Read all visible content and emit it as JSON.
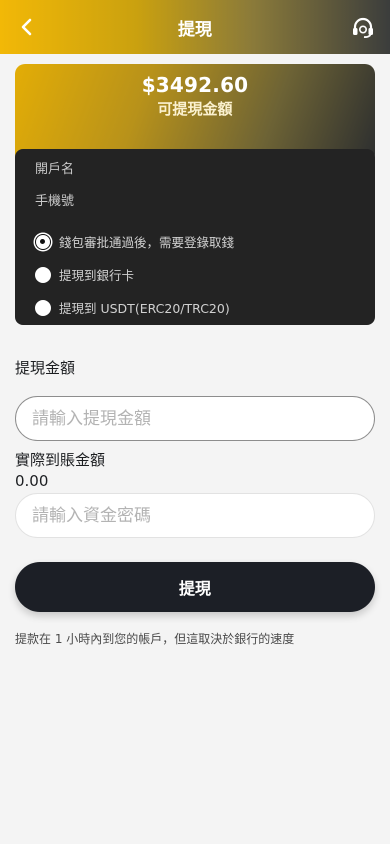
{
  "header": {
    "title": "提現",
    "back_icon": "chevron-left-icon",
    "support_icon": "headset-icon"
  },
  "balance": {
    "amount": "$3492.60",
    "label": "可提現金額"
  },
  "account": {
    "name_label": "開戶名",
    "phone_label": "手機號",
    "options": [
      {
        "label": "錢包審批通過後，需要登錄取錢",
        "selected": true
      },
      {
        "label": "提現到銀行卡",
        "selected": false
      },
      {
        "label": "提現到 USDT(ERC20/TRC20)",
        "selected": false
      }
    ]
  },
  "form": {
    "amount_label": "提現金額",
    "amount_placeholder": "請輸入提現金額",
    "actual_label": "實際到賬金額",
    "actual_value": "0.00",
    "password_placeholder": "請輸入資金密碼",
    "submit_label": "提現"
  },
  "note": "提款在 1 小時內到您的帳戶，但這取決於銀行的速度",
  "colors": {
    "accent_gold": "#f2b807",
    "dark_panel": "#232323",
    "button_dark": "#1c1f26"
  }
}
